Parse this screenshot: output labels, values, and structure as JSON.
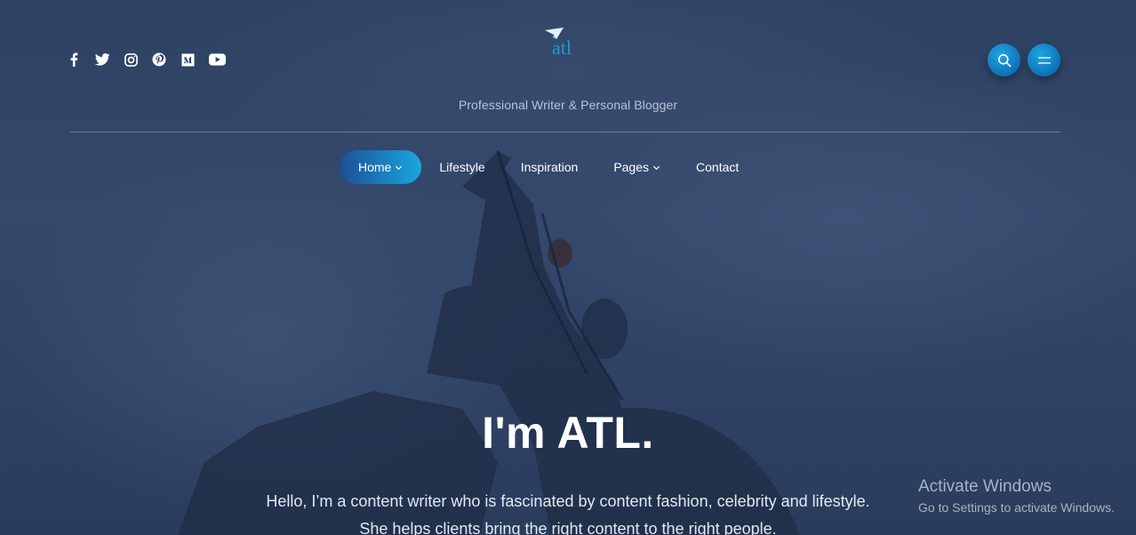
{
  "header": {
    "tagline": "Professional Writer & Personal Blogger",
    "logo_text": "atl",
    "socials": [
      {
        "icon": "facebook-icon"
      },
      {
        "icon": "twitter-icon"
      },
      {
        "icon": "instagram-icon"
      },
      {
        "icon": "pinterest-icon"
      },
      {
        "icon": "medium-icon"
      },
      {
        "icon": "youtube-icon"
      }
    ],
    "search_icon": "search-icon",
    "menu_icon": "menu-icon"
  },
  "nav": {
    "items": [
      {
        "label": "Home",
        "has_caret": true,
        "active": true
      },
      {
        "label": "Lifestyle",
        "has_caret": false
      },
      {
        "label": "Inspiration",
        "has_caret": false
      },
      {
        "label": "Pages",
        "has_caret": true
      },
      {
        "label": "Contact",
        "has_caret": false
      }
    ]
  },
  "hero": {
    "headline": "I'm ATL.",
    "intro_line1": "Hello, I’m a content writer who is fascinated by content fashion, celebrity and lifestyle.",
    "intro_line2": "She helps clients bring the right content to the right people."
  },
  "watermark": {
    "title": "Activate Windows",
    "subtitle": "Go to Settings to activate Windows."
  },
  "colors": {
    "accent_start": "#1c4f96",
    "accent_end": "#1aa7de",
    "button": "#1595d4"
  }
}
